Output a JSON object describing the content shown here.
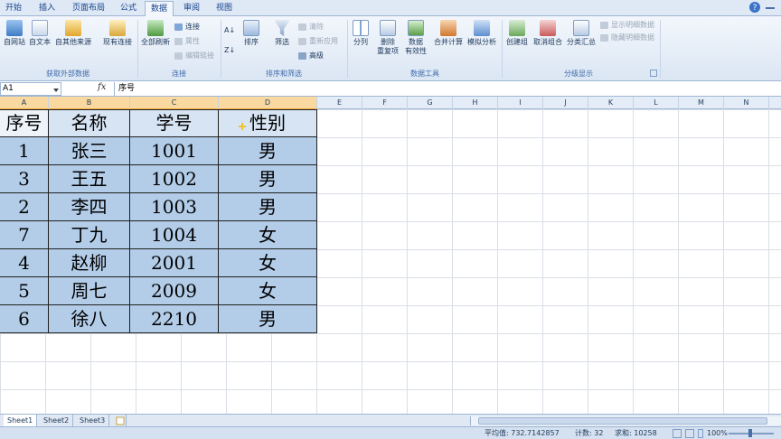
{
  "ribbon_tabs": [
    "开始",
    "插入",
    "页面布局",
    "公式",
    "数据",
    "审阅",
    "视图"
  ],
  "ribbon": {
    "get_external": {
      "from_access": "自网站",
      "from_text": "自文本",
      "from_other": "自其他来源",
      "existing": "现有连接",
      "group_label": "获取外部数据"
    },
    "connections": {
      "refresh_all": "全部刷新",
      "connections": "连接",
      "properties": "属性",
      "edit_links": "编辑链接",
      "group_label": "连接"
    },
    "sort_filter": {
      "sort": "排序",
      "filter": "筛选",
      "clear": "清除",
      "reapply": "重新应用",
      "advanced": "高级",
      "group_label": "排序和筛选"
    },
    "data_tools": {
      "text_to_columns": "分列",
      "remove_dup_1": "删除",
      "remove_dup_2": "重复项",
      "validation_1": "数据",
      "validation_2": "有效性",
      "consolidate": "合并计算",
      "whatif": "模拟分析",
      "group_label": "数据工具"
    },
    "outline": {
      "group": "创建组",
      "ungroup": "取消组合",
      "subtotal": "分类汇总",
      "show_detail": "显示明细数据",
      "hide_detail": "隐藏明细数据",
      "group_label": "分级显示"
    }
  },
  "formula_bar": {
    "name_box": "A1",
    "fx": "fx",
    "content": "序号"
  },
  "columns": [
    "A",
    "B",
    "C",
    "D",
    "E",
    "F",
    "G",
    "H",
    "I",
    "J",
    "K",
    "L",
    "M",
    "N"
  ],
  "table": {
    "headers": [
      "序号",
      "名称",
      "学号",
      "性别"
    ],
    "rows": [
      [
        "1",
        "张三",
        "1001",
        "男"
      ],
      [
        "3",
        "王五",
        "1002",
        "男"
      ],
      [
        "2",
        "李四",
        "1003",
        "男"
      ],
      [
        "7",
        "丁九",
        "1004",
        "女"
      ],
      [
        "4",
        "赵柳",
        "2001",
        "女"
      ],
      [
        "5",
        "周七",
        "2009",
        "女"
      ],
      [
        "6",
        "徐八",
        "2210",
        "男"
      ]
    ]
  },
  "sheets": [
    "Sheet1",
    "Sheet2",
    "Sheet3"
  ],
  "status": {
    "average": "平均值: 732.7142857",
    "count": "计数: 32",
    "sum": "求和: 10258",
    "zoom": "100%"
  },
  "colors": {
    "selection_fill": "#b3cde9",
    "ribbon_bg": "#dbe6f4",
    "selected_header": "#f9d99f"
  }
}
